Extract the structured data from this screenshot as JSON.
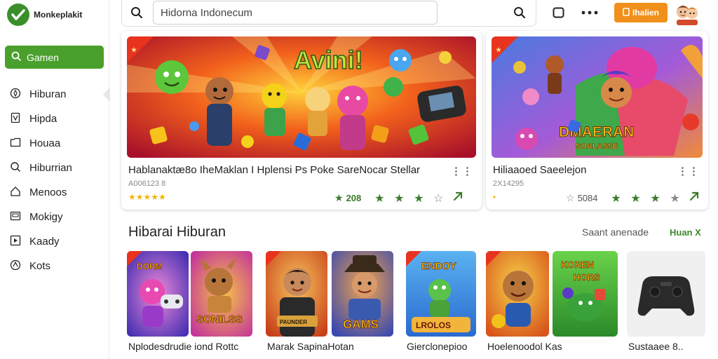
{
  "brand": {
    "name": "Monkeplakit"
  },
  "sidebar": {
    "active": {
      "label": "Gamen"
    },
    "items": [
      {
        "label": "Hiburan",
        "icon": "compass-icon"
      },
      {
        "label": "Hipda",
        "icon": "document-icon"
      },
      {
        "label": "Houaa",
        "icon": "folder-icon"
      },
      {
        "label": "Hiburrian",
        "icon": "search-icon"
      },
      {
        "label": "Menoos",
        "icon": "home-icon"
      },
      {
        "label": "Mokigy",
        "icon": "tablet-icon"
      },
      {
        "label": "Kaady",
        "icon": "play-icon"
      },
      {
        "label": "Kots",
        "icon": "location-icon"
      }
    ]
  },
  "header": {
    "search_placeholder": "Hidorna Indonecum",
    "cta_label": "Ihalien"
  },
  "featured": [
    {
      "banner_text": "Avini!",
      "title": "Hablanaktæ8o IheMaklan I Hplensi Ps Poke SareNocar Stellar",
      "subtitle": "A006123 8",
      "gold_stars": "★★★★★",
      "rating": "208",
      "stars": [
        "★",
        "★",
        "★",
        "☆"
      ]
    },
    {
      "banner_text": "DMAERAN SOALASSE",
      "title": "Hiliaaoed Saeelejon",
      "subtitle": "2X14295",
      "gold_stars": "•",
      "rating": "5084",
      "stars": [
        "★",
        "★",
        "★",
        "★"
      ]
    }
  ],
  "section": {
    "title": "Hibarai Hiburan",
    "link": "Saant anenade",
    "more": "Huan X"
  },
  "tiles": [
    {
      "label": "Nplodesdrudie iond Rottc",
      "tile_text_a": "DORM",
      "tile_text_b": "SONILSS"
    },
    {
      "label": "Marak SapinaHotan",
      "tile_text_a": "PAUNDER",
      "tile_text_b": "GAMS"
    },
    {
      "label": "Gierclonepioo",
      "tile_text_a": "ENDOY",
      "tile_text_b": "LROLOS"
    },
    {
      "label": "Hoelenoodol Kas",
      "tile_text_a": "KOREN",
      "tile_text_b": "HORS"
    },
    {
      "label": "Sustaaee 8..",
      "tile_text_a": "",
      "tile_text_b": ""
    }
  ],
  "colors": {
    "accent_green": "#4aa02c",
    "cta_orange": "#f0901a",
    "rating_green": "#3b7c2b",
    "star_gold": "#f2b400"
  }
}
